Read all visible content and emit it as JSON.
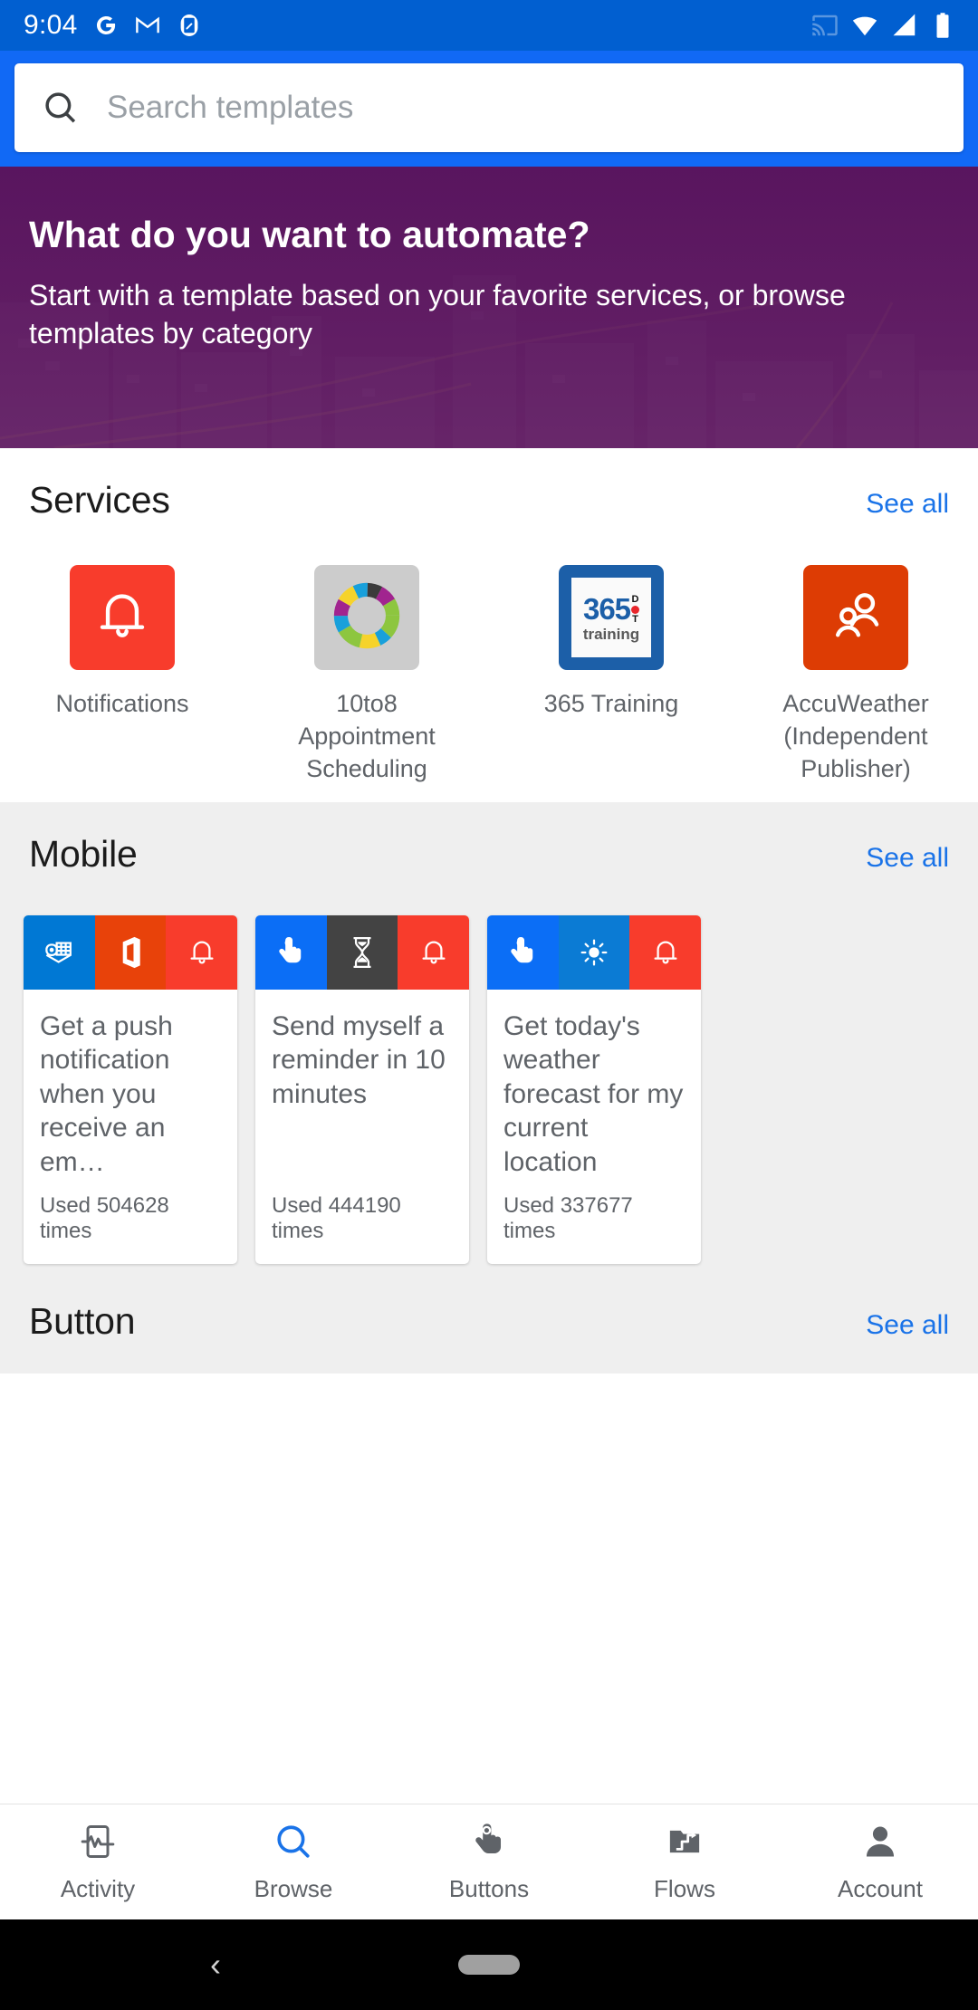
{
  "status_bar": {
    "time": "9:04",
    "left_icons": [
      "google-icon",
      "gmail-icon",
      "app-icon"
    ],
    "right_icons": [
      "cast-icon",
      "wifi-icon",
      "signal-icon",
      "battery-icon"
    ]
  },
  "search": {
    "placeholder": "Search templates",
    "value": "",
    "icon": "search-icon"
  },
  "hero": {
    "title": "What do you want to automate?",
    "subtitle": "Start with a template based on your favorite services, or browse templates by category",
    "overlay_color": "#5d1c61"
  },
  "services_section": {
    "title": "Services",
    "see_all": "See all",
    "items": [
      {
        "label": "Notifications",
        "icon": "bell-icon",
        "bg": "#f83c2c"
      },
      {
        "label": "10to8 Appointment Scheduling",
        "icon": "donut-chart-icon",
        "bg": "#cccccc"
      },
      {
        "label": "365 Training",
        "icon": "365-training-logo",
        "bg": "#1c5fa8",
        "logo": {
          "number": "365",
          "d": "D",
          "t": "T",
          "word": "training"
        }
      },
      {
        "label": "AccuWeather (Independent Publisher)",
        "icon": "people-icon",
        "bg": "#dd3c04"
      }
    ]
  },
  "mobile_section": {
    "title": "Mobile",
    "see_all": "See all",
    "cards": [
      {
        "title": "Get a push notification when you receive an em…",
        "used": "Used 504628 times",
        "icons": [
          {
            "name": "outlook-icon",
            "bg": "#0078d4"
          },
          {
            "name": "office-365-icon",
            "bg": "#e8420a"
          },
          {
            "name": "bell-icon",
            "bg": "#f83c2c"
          }
        ]
      },
      {
        "title": "Send myself a reminder in 10 minutes",
        "used": "Used 444190 times",
        "icons": [
          {
            "name": "button-tap-icon",
            "bg": "#0b6ef6"
          },
          {
            "name": "hourglass-icon",
            "bg": "#434343"
          },
          {
            "name": "bell-icon",
            "bg": "#f83c2c"
          }
        ]
      },
      {
        "title": "Get today's weather forecast for my current location",
        "used": "Used 337677 times",
        "icons": [
          {
            "name": "button-tap-icon",
            "bg": "#0b6ef6"
          },
          {
            "name": "sun-icon",
            "bg": "#0b7bd4"
          },
          {
            "name": "bell-icon",
            "bg": "#f83c2c"
          }
        ]
      }
    ]
  },
  "button_section": {
    "title": "Button",
    "see_all": "See all"
  },
  "bottom_nav": {
    "active": "Browse",
    "items": [
      {
        "label": "Activity",
        "icon": "activity-phone-icon",
        "active": false
      },
      {
        "label": "Browse",
        "icon": "search-icon",
        "active": true
      },
      {
        "label": "Buttons",
        "icon": "button-tap-icon",
        "active": false
      },
      {
        "label": "Flows",
        "icon": "flows-icon",
        "active": false
      },
      {
        "label": "Account",
        "icon": "person-icon",
        "active": false
      }
    ],
    "accent_color": "#1a73e8"
  },
  "system_nav": {
    "back_icon": "back-chevron-icon",
    "home_pill": "home-pill"
  }
}
